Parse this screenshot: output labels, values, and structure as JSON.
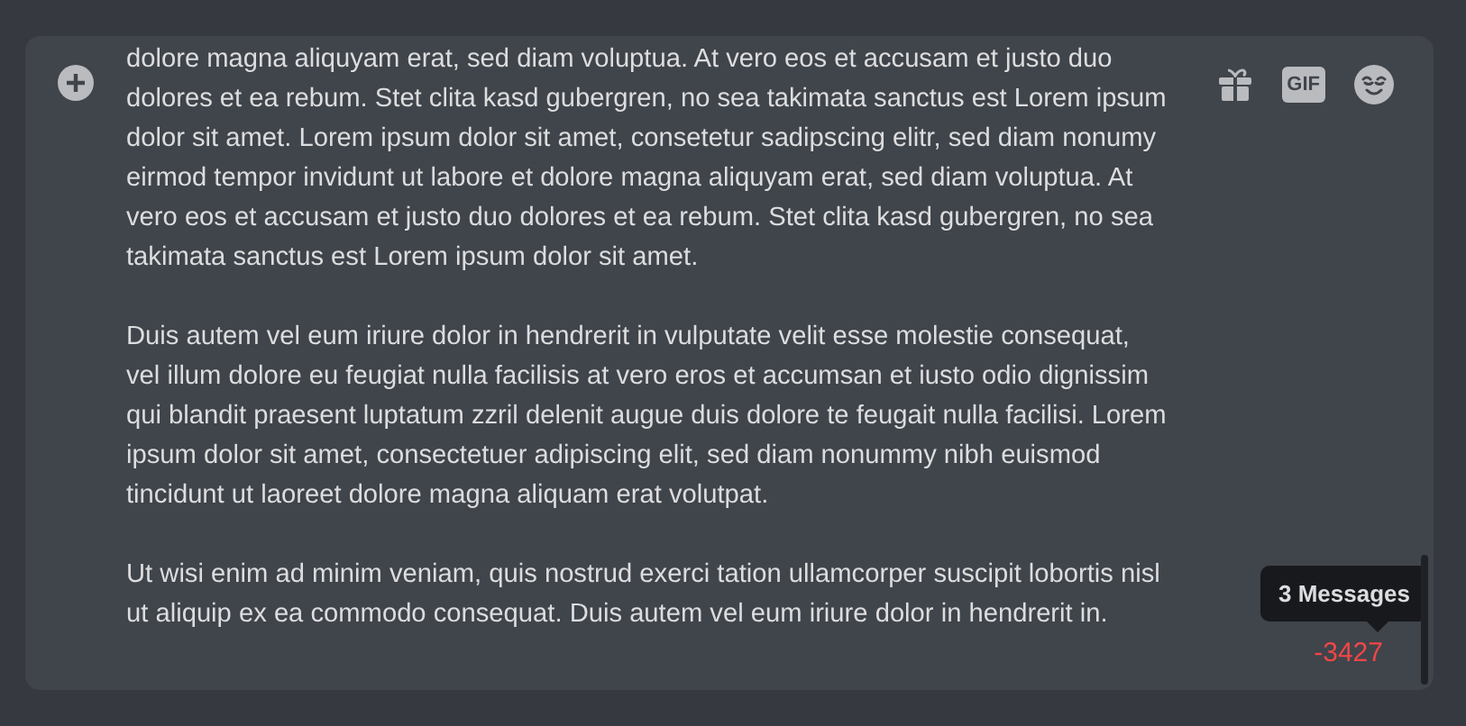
{
  "composer": {
    "paragraphs": [
      "dolore magna aliquyam erat, sed diam voluptua. At vero eos et accusam et justo duo dolores et ea rebum. Stet clita kasd gubergren, no sea takimata sanctus est Lorem ipsum dolor sit amet. Lorem ipsum dolor sit amet, consetetur sadipscing elitr, sed diam nonumy eirmod tempor invidunt ut labore et dolore magna aliquyam erat, sed diam voluptua. At vero eos et accusam et justo duo dolores et ea rebum. Stet clita kasd gubergren, no sea takimata sanctus est Lorem ipsum dolor sit amet.",
      "Duis autem vel eum iriure dolor in hendrerit in vulputate velit esse molestie consequat, vel illum dolore eu feugiat nulla facilisis at vero eros et accumsan et iusto odio dignissim qui blandit praesent luptatum zzril delenit augue duis dolore te feugait nulla facilisi. Lorem ipsum dolor sit amet, consectetuer adipiscing elit, sed diam nonummy nibh euismod tincidunt ut laoreet dolore magna aliquam erat volutpat.",
      "Ut wisi enim ad minim veniam, quis nostrud exerci tation ullamcorper suscipit lobortis nisl ut aliquip ex ea commodo consequat. Duis autem vel eum iriure dolor in hendrerit in."
    ],
    "gif_label": "GIF",
    "char_counter": {
      "text": "-3427",
      "over_limit": true
    },
    "tooltip": "3 Messages"
  }
}
